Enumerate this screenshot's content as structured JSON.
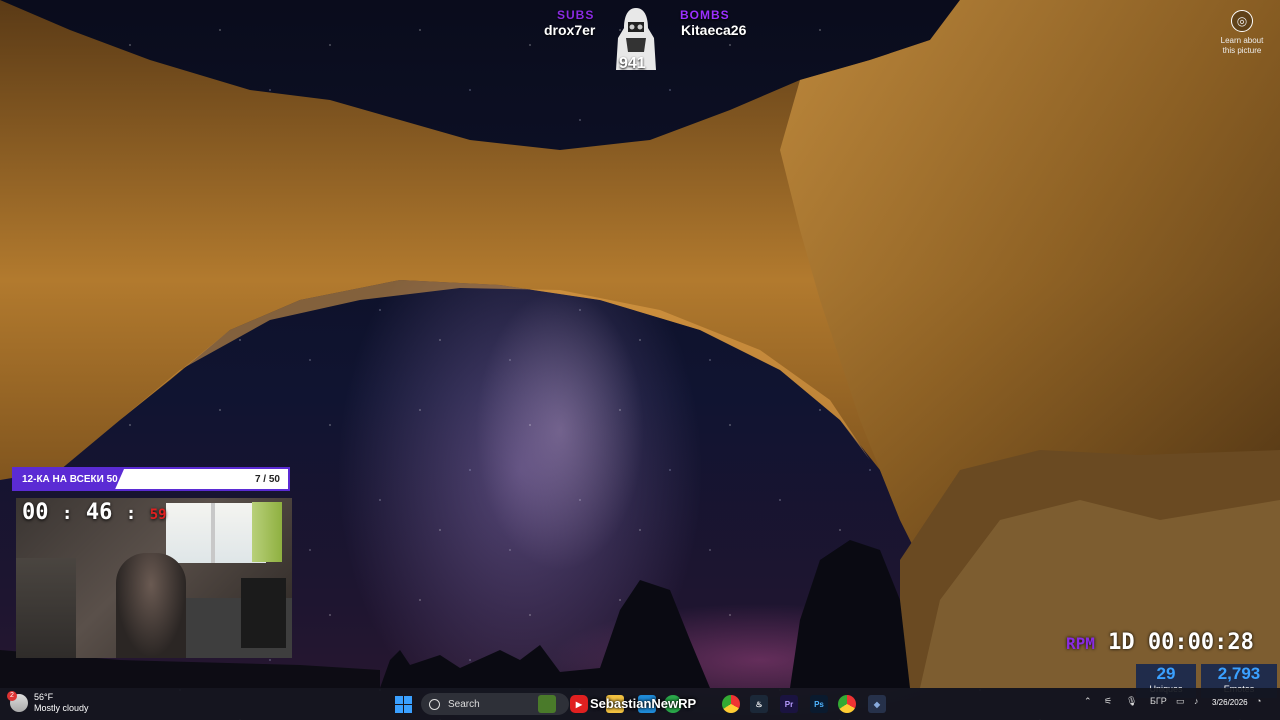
{
  "overlay": {
    "subs_label": "SUBS",
    "subs_name": "drox7er",
    "bombs_label": "BOMBS",
    "bombs_name": "Kitaeca26",
    "count": "941",
    "learn_line1": "Learn about",
    "learn_line2": "this picture"
  },
  "stream": {
    "challenge_title": "12-КА НА ВСЕКИ 50",
    "challenge_progress": "7 / 50",
    "timer_h": "00",
    "timer_m": "46",
    "timer_s": "59",
    "rpm_label": "RPM",
    "rpm_day": "1D",
    "rpm_time": "00:00:28",
    "uniques_value": "29",
    "uniques_label": "Uniques",
    "emotes_value": "2,793",
    "emotes_label": "Emotes",
    "overlay_marquee": "SebastianNewRP"
  },
  "taskbar": {
    "weather_temp": "56°F",
    "weather_desc": "Mostly cloudy",
    "weather_badge": "2",
    "search_placeholder": "Search",
    "language": "БГР",
    "date": "3/26/2026",
    "apps": [
      "winamp",
      "youtube",
      "file-explorer",
      "edge",
      "chrome",
      "steam",
      "premiere",
      "photoshop",
      "chrome-2",
      "app"
    ]
  },
  "colors": {
    "accent_purple": "#8a2be2",
    "accent_blue": "#3aa0ff",
    "timer_red": "#e02020"
  }
}
